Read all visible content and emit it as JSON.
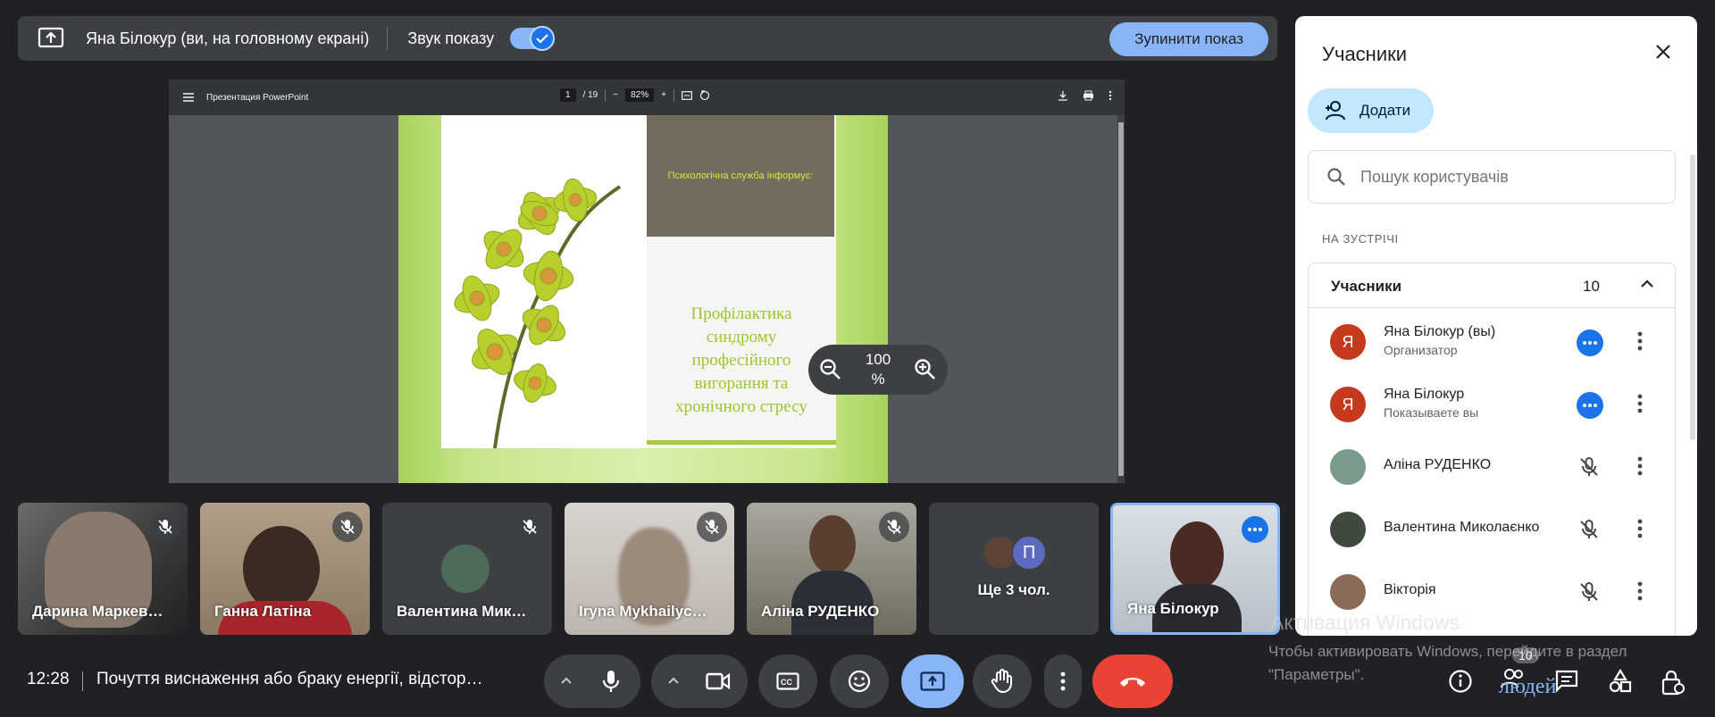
{
  "banner": {
    "presenter": "Яна Білокур (ви, на головному екрані)",
    "sound_label": "Звук показу",
    "sound_on": true,
    "stop_label": "Зупинити показ"
  },
  "viewer": {
    "doc_title": "Презентация PowerPoint",
    "page_current": "1",
    "page_total": "/ 19",
    "zoom": "82%",
    "slide_service": "Психологічна служба інформує:",
    "slide_title_lines": [
      "Профілактика",
      "синдрому",
      "професійного",
      "вигорання та",
      "хронічного стресу"
    ],
    "zoom_control_value": "100",
    "zoom_control_unit": "%"
  },
  "tiles": [
    {
      "name": "Дарина Маркев…",
      "muted": true
    },
    {
      "name": "Ганна Латіна",
      "muted": true
    },
    {
      "name": "Валентина Мик…",
      "muted": true
    },
    {
      "name": "Iryna Mykhailyc…",
      "muted": true
    },
    {
      "name": "Аліна РУДЕНКО",
      "muted": true
    },
    {
      "name": "Ще 3 чол.",
      "avatar_letter": "П"
    },
    {
      "name": "Яна Білокур",
      "active": true
    }
  ],
  "bottom": {
    "time": "12:28",
    "meeting_title": "Почуття виснаження або браку енергії, відстор…",
    "people_badge": "10",
    "people_word": "людей"
  },
  "watermark": {
    "title": "Активация Windows",
    "subtitle": "Чтобы активировать Windows, перейдите в раздел \"Параметры\"."
  },
  "panel": {
    "title": "Учасники",
    "add_label": "Додати",
    "search_placeholder": "Пошук користувачів",
    "section_label": "НА ЗУСТРІЧІ",
    "list_label": "Учасники",
    "count": "10",
    "participants": [
      {
        "name": "Яна Білокур (вы)",
        "role": "Организатор",
        "avatar": "Я",
        "color": "#c5391c",
        "status": "more"
      },
      {
        "name": "Яна Білокур",
        "role": "Показываете вы",
        "avatar": "Я",
        "color": "#c5391c",
        "status": "more"
      },
      {
        "name": "Аліна РУДЕНКО",
        "role": "",
        "avatar": "",
        "color": "#7a8a7c",
        "status": "muted"
      },
      {
        "name": "Валентина Миколаєнко",
        "role": "",
        "avatar": "",
        "color": "#4a4e4a",
        "status": "muted"
      },
      {
        "name": "Вікторія",
        "role": "",
        "avatar": "",
        "color": "#8a6a58",
        "status": "muted"
      }
    ]
  },
  "colors": {
    "bg": "#202124",
    "accent": "#8ab4f8",
    "hangup": "#ea4335",
    "slide_green": "#9bc72a"
  }
}
